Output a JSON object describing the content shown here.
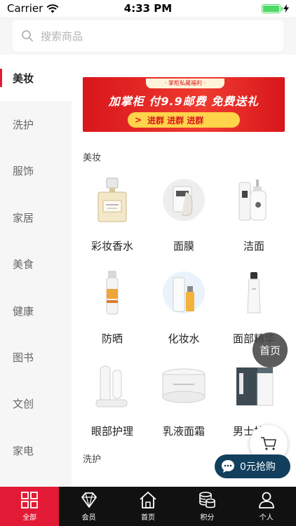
{
  "status_bar": {
    "carrier": "Carrier",
    "time": "4:33 PM"
  },
  "search": {
    "placeholder": "搜索商品"
  },
  "sidebar": {
    "items": [
      {
        "label": "美妆",
        "active": true
      },
      {
        "label": "洗护"
      },
      {
        "label": "服饰"
      },
      {
        "label": "家居"
      },
      {
        "label": "美食"
      },
      {
        "label": "健康"
      },
      {
        "label": "图书"
      },
      {
        "label": "文创"
      },
      {
        "label": "家电"
      }
    ]
  },
  "banner": {
    "tag": "· 掌柜私藏福利 ·",
    "main": "加掌柜   付9.9邮费 免费送礼",
    "sub": "进群  进群  进群"
  },
  "sections": [
    {
      "title": "美妆",
      "items": [
        {
          "label": "彩妆香水",
          "icon": "perfume-bottle"
        },
        {
          "label": "面膜",
          "icon": "face-mask"
        },
        {
          "label": "洁面",
          "icon": "cleanser-bottles"
        },
        {
          "label": "防晒",
          "icon": "sunscreen-spray"
        },
        {
          "label": "化妆水",
          "icon": "toner-bottle"
        },
        {
          "label": "面部精华",
          "icon": "serum-tube"
        },
        {
          "label": "眼部护理",
          "icon": "eye-care-device"
        },
        {
          "label": "乳液面霜",
          "icon": "cream-jar"
        },
        {
          "label": "男士护理",
          "icon": "men-care-box"
        }
      ]
    },
    {
      "title": "洗护"
    }
  ],
  "floating": {
    "home_label": "首页",
    "chat_label": "0元抢购"
  },
  "tabbar": {
    "items": [
      {
        "label": "全部",
        "icon": "grid-icon",
        "active": true
      },
      {
        "label": "会员",
        "icon": "diamond-icon"
      },
      {
        "label": "首页",
        "icon": "home-icon"
      },
      {
        "label": "积分",
        "icon": "coins-icon"
      },
      {
        "label": "个人",
        "icon": "person-icon"
      }
    ]
  },
  "colors": {
    "accent": "#e31a35",
    "tabbar_bg": "#111111",
    "chat_bg": "#123f5e",
    "banner_red": "#d8161b"
  }
}
